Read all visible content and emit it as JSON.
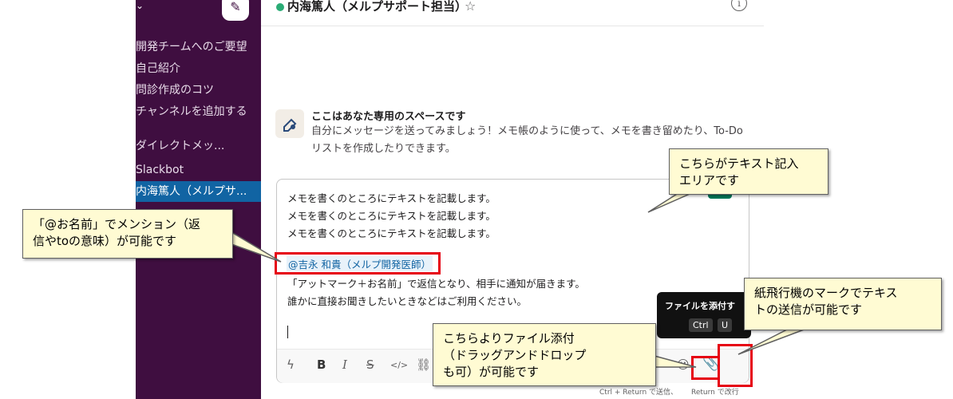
{
  "sidebar": {
    "items": [
      "開発チームへのご要望",
      "自己紹介",
      "問診作成のコツ",
      "チャンネルを追加する",
      "ダイレクトメッ...",
      "Slackbot",
      "内海篤人（メルプサ..."
    ]
  },
  "header": {
    "title": "内海篤人（メルプサポート担当）"
  },
  "intro": {
    "title": "ここはあなた専用のスペースです",
    "text": "自分にメッセージを送ってみましょう！メモ帳のように使って、メモを書き留めたり、To-Do リストを作成したりできます。"
  },
  "composer": {
    "lines": [
      "メモを書くのところにテキストを記載します。",
      "メモを書くのところにテキストを記載します。",
      "メモを書くのところにテキストを記載します。"
    ],
    "mention": "@吉永 和貴（メルプ開発医師）",
    "after_lines": [
      "「アットマーク＋お名前」で返信となり、相手に通知が届きます。",
      "誰かに直接お聞きしたいときなどはご利用ください。"
    ],
    "hint_send": "Ctrl + Return で送信、",
    "hint_newline": "Return で改行"
  },
  "tooltip": {
    "title": "ファイルを添付す",
    "key1": "Ctrl",
    "key2": "U"
  },
  "callouts": {
    "text_area": [
      "こちらがテキスト記入",
      "エリアです"
    ],
    "mention": [
      "「@お名前」でメンション（返",
      "信やtoの意味）が可能です"
    ],
    "send": [
      "紙飛行機のマークでテキス",
      "トの送信が可能です"
    ],
    "attach": [
      "こちらよりファイル添付",
      "（ドラッグアンドドロップ",
      "も可）が可能です"
    ]
  },
  "colors": {
    "sidebar_bg": "#3f0e40",
    "active_item": "#1164a3",
    "send_button": "#007a5a",
    "callout_bg": "#fffbd3",
    "highlight_red": "#e60012"
  }
}
